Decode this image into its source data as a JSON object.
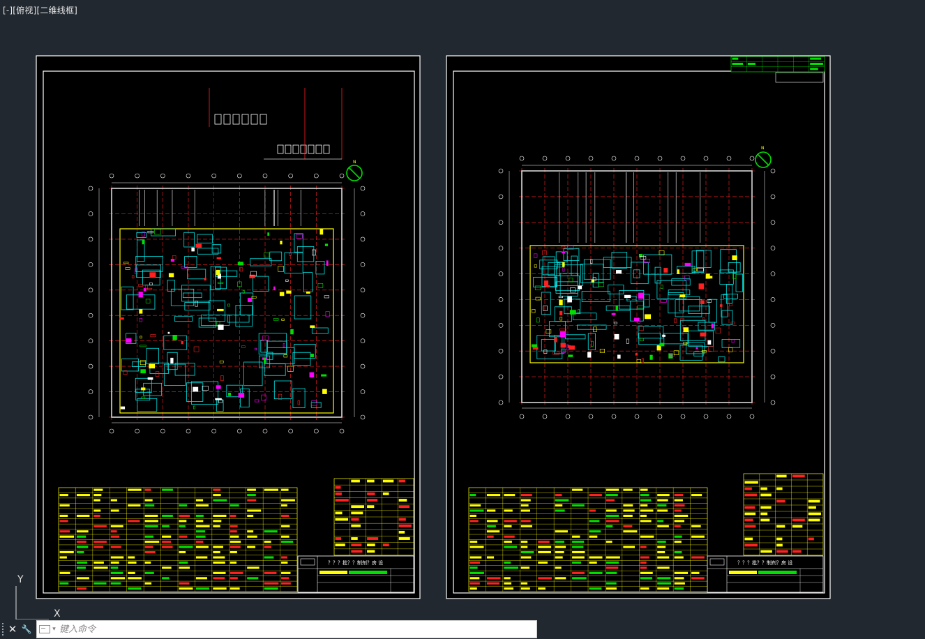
{
  "viewport": {
    "parts": [
      "[-]",
      "[俯视]",
      "[二维线框]"
    ]
  },
  "ucs": {
    "y_label": "Y",
    "x_label": "X"
  },
  "command_line": {
    "close_glyph": "✕",
    "settings_glyph": "🔧",
    "placeholder": "键入命令"
  },
  "colors": {
    "canvas": "#212830",
    "paper": "#000000",
    "border": "#ffffff",
    "wall": "#d7d7d7",
    "room": "#00e5e5",
    "yellow": "#ffff00",
    "red": "#ff2020",
    "magenta": "#ff00ff",
    "green": "#00e000"
  },
  "sheets": [
    {
      "id": "sheet-1",
      "title_block": "？？？批？？制剂？房 设",
      "north_label": "N"
    },
    {
      "id": "sheet-2",
      "title_block": "？？？批？？制剂？房 设",
      "north_label": "N"
    }
  ]
}
